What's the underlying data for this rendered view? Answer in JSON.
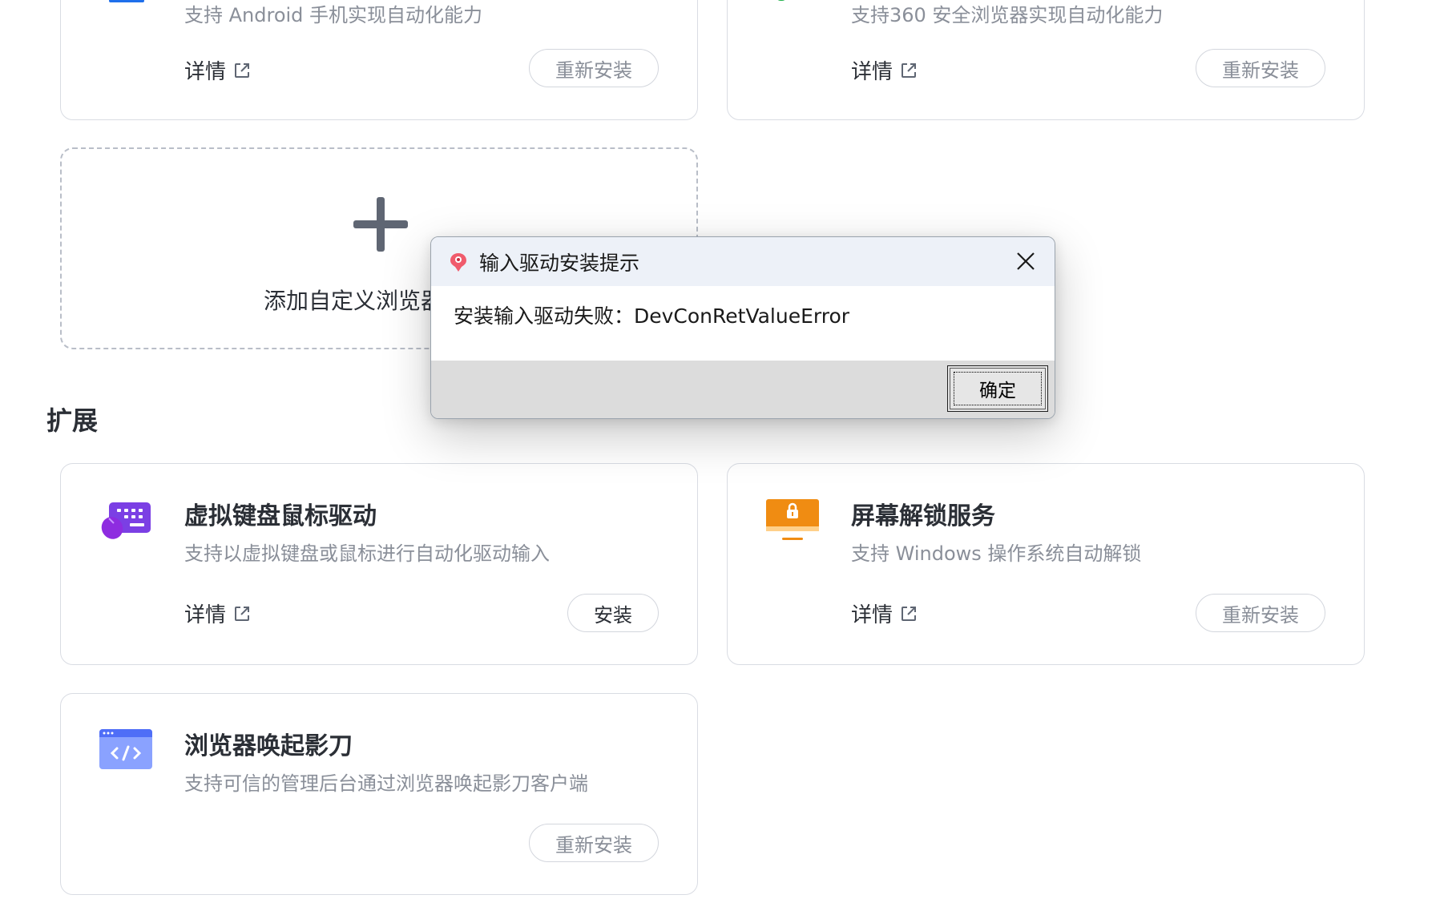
{
  "cards_top": [
    {
      "desc": "支持 Android 手机实现自动化能力",
      "details": "详情",
      "action": "重新安装"
    },
    {
      "desc": "支持360 安全浏览器实现自动化能力",
      "details": "详情",
      "action": "重新安装"
    }
  ],
  "add_browser": {
    "label": "添加自定义浏览器"
  },
  "section": {
    "title": "扩展"
  },
  "extensions": [
    {
      "title": "虚拟键盘鼠标驱动",
      "desc": "支持以虚拟键盘或鼠标进行自动化驱动输入",
      "details": "详情",
      "action": "安装",
      "icon": "keyboard-mouse-icon"
    },
    {
      "title": "屏幕解锁服务",
      "desc": "支持 Windows 操作系统自动解锁",
      "details": "详情",
      "action": "重新安装",
      "icon": "screen-lock-icon"
    },
    {
      "title": "浏览器唤起影刀",
      "desc": "支持可信的管理后台通过浏览器唤起影刀客户端",
      "action": "重新安装",
      "icon": "browser-code-icon"
    }
  ],
  "dialog": {
    "title": "输入驱动安装提示",
    "message": "安装输入驱动失败：DevConRetValueError",
    "ok": "确定"
  },
  "colors": {
    "keyboard_icon": "#7b3fe4",
    "lock_icon": "#f08c12",
    "code_icon": "#4f6ef7"
  }
}
